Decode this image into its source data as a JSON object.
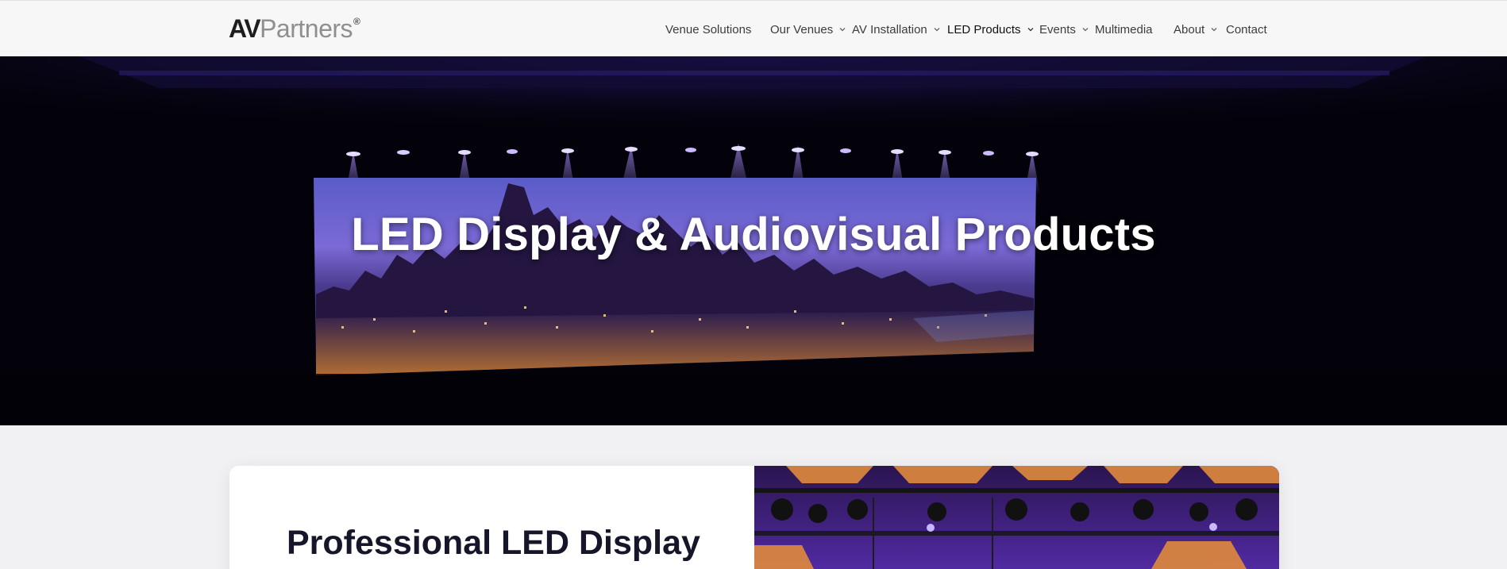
{
  "header": {
    "logo": {
      "primary": "AV",
      "secondary": "Partners",
      "mark": "®"
    },
    "nav": [
      {
        "label": "Venue Solutions",
        "dropdown": false,
        "active": false
      },
      {
        "label": "Our Venues",
        "dropdown": true,
        "active": false
      },
      {
        "label": "AV Installation",
        "dropdown": true,
        "active": false
      },
      {
        "label": "LED Products",
        "dropdown": true,
        "active": true
      },
      {
        "label": "Events",
        "dropdown": true,
        "active": false
      },
      {
        "label": "Multimedia",
        "dropdown": false,
        "active": false
      },
      {
        "label": "About",
        "dropdown": true,
        "active": false
      },
      {
        "label": "Contact",
        "dropdown": false,
        "active": false
      }
    ]
  },
  "hero": {
    "title": "LED Display & Audiovisual Products"
  },
  "intro": {
    "title": "Professional LED Display"
  },
  "colors": {
    "header_bg": "#f7f7f7",
    "page_bg": "#f1f1f3",
    "hero_bg": "#04030a",
    "title_dark": "#15162a",
    "accent_purple": "#6b3fd6"
  }
}
